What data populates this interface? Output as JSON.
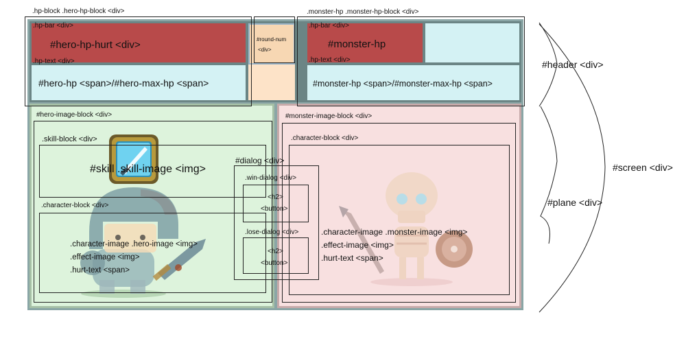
{
  "labels": {
    "hero_hp_block": ".hp-block .hero-hp-block <div>",
    "monster_hp_block": ".monster-hp .monster-hp-block <div>",
    "hp_bar_hero": ".hp-bar <div>",
    "hp_text_hero": ".hp-text <div>",
    "hp_bar_monster": ".hp-bar <div>",
    "hp_text_monster": ".hp-text <div>",
    "hero_hp_hurt": "#hero-hp-hurt <div>",
    "hero_hp_text": "#hero-hp <span>/#hero-max-hp <span>",
    "round_num_line1": "#round-num",
    "round_num_line2": "<div>",
    "monster_hp_bar": "#monster-hp",
    "monster_hp_text": "#monster-hp <span>/#monster-max-hp <span>",
    "hero_image_block": "#hero-image-block <div>",
    "monster_image_block": "#monster-image-block <div>",
    "skill_block": ".skill-block <div>",
    "skill_image": "#skill .skill-image <img>",
    "hero_character_block": ".character-block <div>",
    "monster_character_block": ".character-block <div>",
    "dialog": "#dialog <div>",
    "win_dialog": ".win-dialog <div>",
    "lose_dialog": ".lose-dialog <div>",
    "h2": "<h2>",
    "button": "<button>",
    "hero_image_lines": [
      ".character-image .hero-image <img>",
      ".effect-image <img>",
      ".hurt-text <span>"
    ],
    "monster_image_lines": [
      ".character-image .monster-image <img>",
      ".effect-image <img>",
      ".hurt-text <span>"
    ],
    "header": "#header <div>",
    "screen": "#screen <div>",
    "plane": "#plane <div>"
  },
  "colors": {
    "hp_hurt": "#b84a4a",
    "hp_bar_bg": "#d4f2f4",
    "round_bg": "#fde3c8",
    "hero_plane": "#ddf3dc",
    "monster_plane": "#f8e0e0",
    "frame": "#6b8585"
  }
}
